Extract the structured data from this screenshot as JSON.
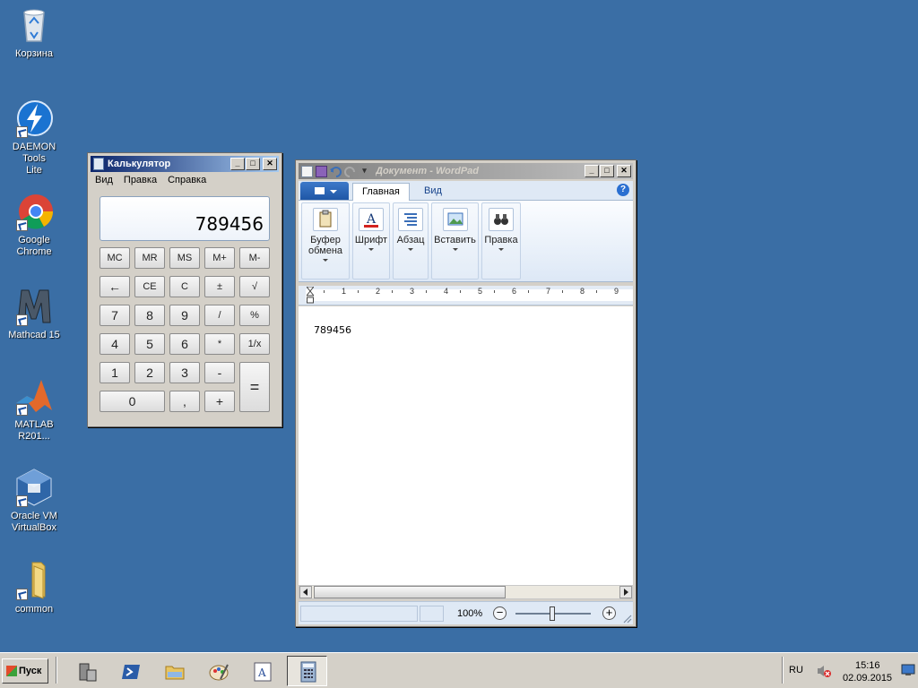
{
  "desktop": {
    "icons": [
      {
        "label": "Корзина"
      },
      {
        "label_line1": "DAEMON Tools",
        "label_line2": "Lite"
      },
      {
        "label": "Google Chrome"
      },
      {
        "label": "Mathcad 15"
      },
      {
        "label_line1": "MATLAB",
        "label_line2": "R201..."
      },
      {
        "label_line1": "Oracle VM",
        "label_line2": "VirtualBox"
      },
      {
        "label": "common"
      }
    ]
  },
  "calculator": {
    "title": "Калькулятор",
    "menu": [
      "Вид",
      "Правка",
      "Справка"
    ],
    "display": "789456",
    "buttons": {
      "mc": "MC",
      "mr": "MR",
      "ms": "MS",
      "mplus": "M+",
      "mminus": "M-",
      "back": "←",
      "ce": "CE",
      "c": "C",
      "plusminus": "±",
      "sqrt": "√",
      "d7": "7",
      "d8": "8",
      "d9": "9",
      "div": "/",
      "pct": "%",
      "d4": "4",
      "d5": "5",
      "d6": "6",
      "mul": "*",
      "recip": "1/x",
      "d1": "1",
      "d2": "2",
      "d3": "3",
      "sub": "-",
      "eq": "=",
      "d0": "0",
      "dot": ",",
      "add": "+"
    }
  },
  "wordpad": {
    "title": "Документ - WordPad",
    "tabs": [
      "Главная",
      "Вид"
    ],
    "help": "?",
    "groups": [
      {
        "line1": "Буфер",
        "line2": "обмена"
      },
      {
        "line1": "Шрифт"
      },
      {
        "line1": "Абзац"
      },
      {
        "line1": "Вставить"
      },
      {
        "line1": "Правка"
      }
    ],
    "ruler": [
      "1",
      "2",
      "3",
      "4",
      "5",
      "6",
      "7",
      "8",
      "9"
    ],
    "document_text": "789456",
    "zoom": "100%",
    "zoom_minus": "−",
    "zoom_plus": "+"
  },
  "taskbar": {
    "start_label": "Пуск",
    "language": "RU",
    "time": "15:16",
    "date": "02.09.2015",
    "apps": [
      "server-manager-icon",
      "powershell-icon",
      "explorer-icon",
      "paint-icon",
      "wordpad-icon",
      "calculator-icon"
    ],
    "active_app": "calculator-icon"
  },
  "colors": {
    "desktop": "#3a6ea5",
    "title_active": "#0a246a",
    "title_inactive": "#808080"
  }
}
